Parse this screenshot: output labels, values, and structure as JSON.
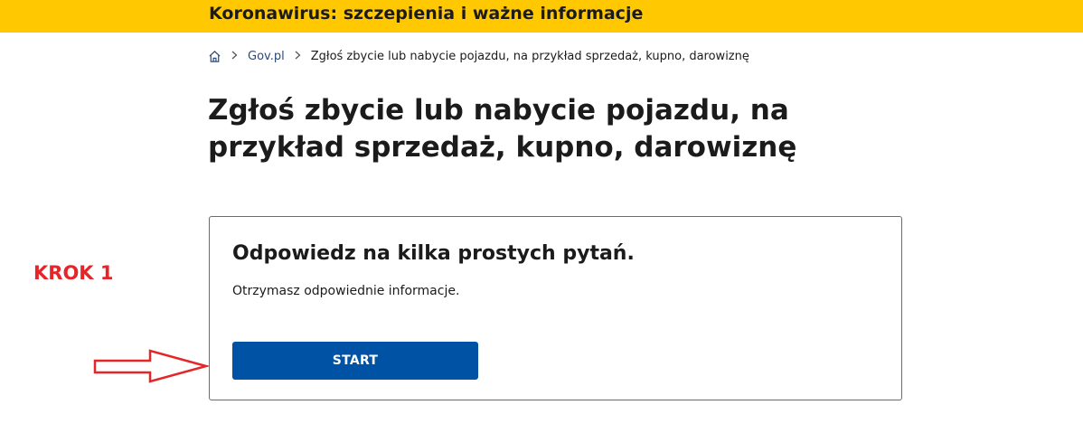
{
  "banner": {
    "text": "Koronawirus: szczepienia i ważne informacje",
    "color": "#ffc800"
  },
  "breadcrumb": {
    "home_icon": "home-icon",
    "separator_icon": "chevron-right-icon",
    "items": [
      {
        "label": "Gov.pl"
      },
      {
        "label": "Zgłoś zbycie lub nabycie pojazdu, na przykład sprzedaż, kupno, darowiznę"
      }
    ]
  },
  "page": {
    "title": "Zgłoś zbycie lub nabycie pojazdu, na przykład sprzedaż, kupno, darowiznę"
  },
  "annotation": {
    "step_label": "KROK 1",
    "arrow_icon": "arrow-right-icon",
    "color": "#e52629"
  },
  "card": {
    "title": "Odpowiedz na kilka prostych pytań.",
    "description": "Otrzymasz odpowiednie informacje.",
    "button_label": "START",
    "button_color": "#0052a5"
  }
}
